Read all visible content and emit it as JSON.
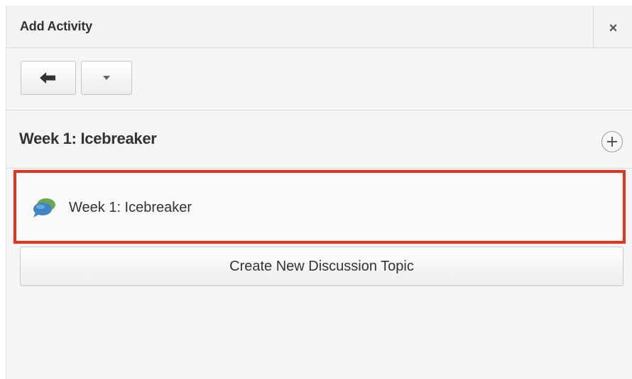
{
  "header": {
    "title": "Add Activity",
    "close_label": "×"
  },
  "toolbar": {
    "back_icon": "arrow-left-icon",
    "menu_icon": "caret-down-icon"
  },
  "section": {
    "title": "Week 1: Icebreaker",
    "add_icon": "plus-circle-icon"
  },
  "items": [
    {
      "label": "Week 1: Icebreaker",
      "icon": "discussion-icon"
    }
  ],
  "actions": {
    "create_label": "Create New Discussion Topic"
  },
  "colors": {
    "highlight_border": "#e8321c",
    "panel_background": "#f5f5f5",
    "bubble_green": "#6aa84f",
    "bubble_blue": "#3d85c6"
  }
}
